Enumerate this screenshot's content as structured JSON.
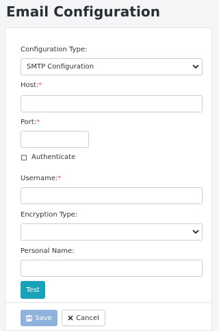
{
  "page": {
    "title": "Email Configuration"
  },
  "form": {
    "config_type": {
      "label": "Configuration Type:",
      "value": "SMTP Configuration"
    },
    "host": {
      "label": "Host:",
      "required_mark": "*",
      "value": ""
    },
    "port": {
      "label": "Port:",
      "required_mark": "*",
      "value": ""
    },
    "authenticate": {
      "label": "Authenticate",
      "checked": false
    },
    "username": {
      "label": "Username:",
      "required_mark": "*",
      "value": ""
    },
    "encryption_type": {
      "label": "Encryption Type:",
      "value": ""
    },
    "personal_name": {
      "label": "Personal Name:",
      "value": ""
    }
  },
  "actions": {
    "test_label": "Test",
    "save_label": "Save",
    "cancel_label": "Cancel"
  },
  "colors": {
    "test_button": "#17a2b8",
    "save_button": "#8fb2dc",
    "required": "#d9534f"
  },
  "icons": {
    "select_chevron": "chevron-down-icon",
    "save": "floppy-disk-icon",
    "cancel": "close-icon"
  }
}
